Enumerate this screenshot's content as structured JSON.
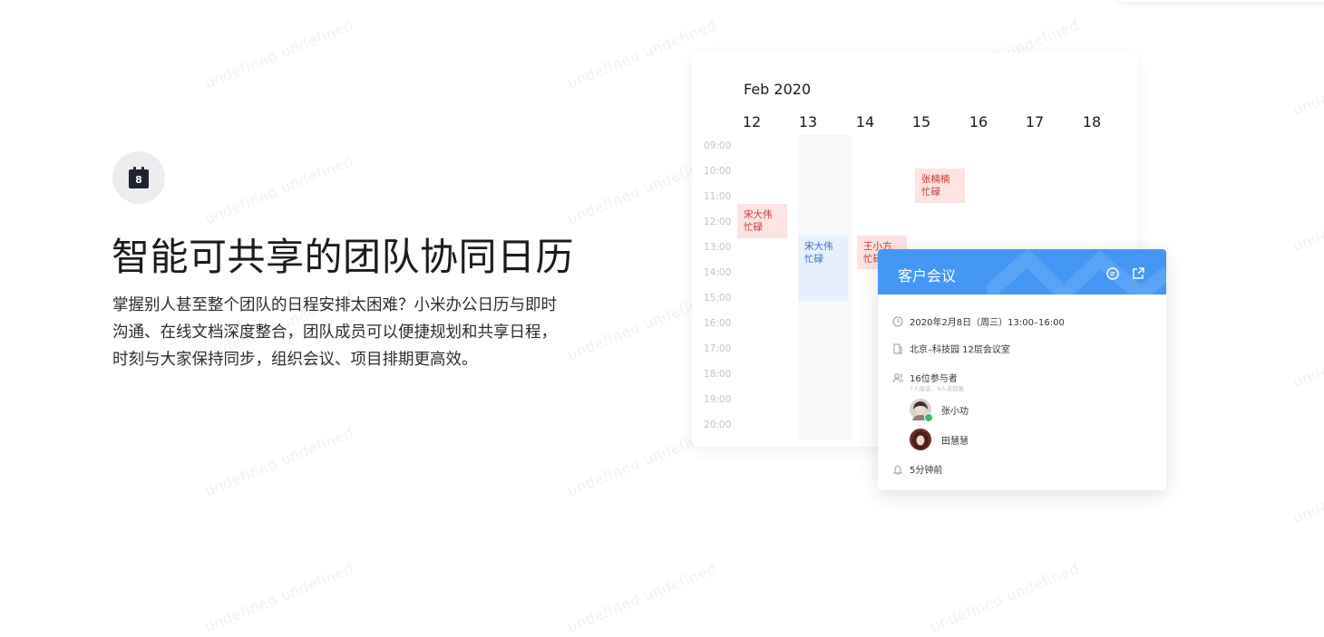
{
  "feature": {
    "icon": {
      "name": "calendar-icon",
      "day": "8"
    },
    "headline": "智能可共享的团队协同日历",
    "description_lines": [
      "掌握别人甚至整个团队的日程安排太困难？小米办公日历与即时",
      "沟通、在线文档深度整合，团队成员可以便捷规划和共享日程，",
      "时刻与大家保持同步，组织会议、项目排期更高效。"
    ]
  },
  "watermark_text": "undefined undefined",
  "calendar": {
    "month": "Feb 2020",
    "days": [
      "12",
      "13",
      "14",
      "15",
      "16",
      "17",
      "18"
    ],
    "hours": [
      "09:00",
      "10:00",
      "11:00",
      "12:00",
      "13:00",
      "14:00",
      "15:00",
      "16:00",
      "17:00",
      "18:00",
      "19:00",
      "20:00"
    ],
    "events": [
      {
        "name": "宋大伟",
        "status": "忙碌",
        "day": "12",
        "color": "red"
      },
      {
        "name": "宋大伟",
        "status": "忙碌",
        "day": "13",
        "color": "blue"
      },
      {
        "name": "王小方",
        "status": "忙碌",
        "day": "14",
        "color": "red"
      },
      {
        "name": "张楠楠",
        "status": "忙碌",
        "day": "15",
        "color": "red"
      }
    ]
  },
  "meeting": {
    "title": "客户会议",
    "datetime": "2020年2月8日（周三）13:00–16:00",
    "location": "北京–科技园 12层会议室",
    "attendees_summary": "16位参与者",
    "attendees_sub": "7人接受，9人未回复",
    "attendees": [
      {
        "name": "张小功",
        "accepted": true
      },
      {
        "name": "田慧慧",
        "accepted": false
      }
    ],
    "reminder": "5分钟前"
  },
  "colors": {
    "accent_blue": "#4597f6",
    "busy_red_bg": "#fde3e2",
    "busy_red_text": "#c4393a",
    "busy_blue_bg": "#e8f0fd",
    "busy_blue_text": "#3a6cc6"
  }
}
